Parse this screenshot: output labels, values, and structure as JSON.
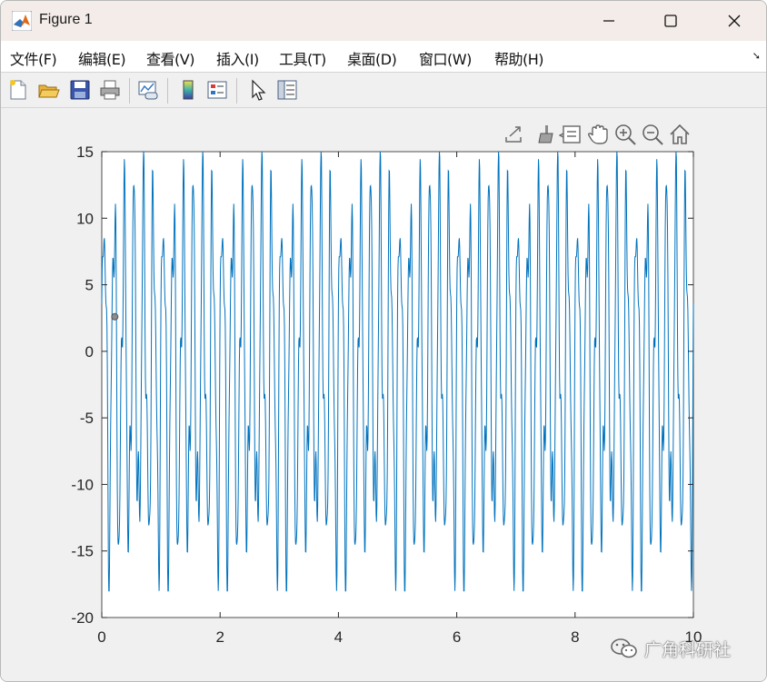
{
  "window": {
    "title": "Figure 1"
  },
  "menu": {
    "items": [
      "文件(F)",
      "编辑(E)",
      "查看(V)",
      "插入(I)",
      "工具(T)",
      "桌面(D)",
      "窗口(W)",
      "帮助(H)"
    ]
  },
  "toolbar": {
    "icons": [
      "new-figure-icon",
      "open-file-icon",
      "save-icon",
      "print-icon",
      "link-plot-icon",
      "colorbar-icon",
      "legend-icon",
      "pointer-icon",
      "property-inspector-icon"
    ]
  },
  "axes_toolbar": {
    "icons": [
      "export-icon",
      "brush-icon",
      "data-tips-icon",
      "pan-icon",
      "zoom-in-icon",
      "zoom-out-icon",
      "home-icon"
    ]
  },
  "colors": {
    "line": "#0072bd",
    "axes_bg": "#ffffff",
    "figure_bg": "#f0f0f0",
    "title_bg": "#f3ece9"
  },
  "chart_data": {
    "type": "line",
    "xlim": [
      0,
      10
    ],
    "ylim": [
      -20,
      15
    ],
    "xticks": [
      0,
      2,
      4,
      6,
      8,
      10
    ],
    "yticks": [
      -20,
      -15,
      -10,
      -5,
      0,
      5,
      10,
      15
    ],
    "xtick_labels": [
      "0",
      "2",
      "4",
      "6",
      "8",
      "10"
    ],
    "ytick_labels": [
      "-20",
      "-15",
      "-10",
      "-5",
      "0",
      "5",
      "10",
      "15"
    ],
    "grid": false,
    "series": [
      {
        "color": "#0072bd",
        "signal": {
          "amplitudes": [
            12,
            4,
            2
          ],
          "frequencies": [
            6,
            13,
            21
          ],
          "offset": -1.5,
          "min": -18,
          "max": 15,
          "samples": 1600
        }
      }
    ],
    "marker_point": {
      "x": 0.22,
      "y": 2.6
    }
  },
  "watermark": {
    "text": "广角科研社"
  }
}
